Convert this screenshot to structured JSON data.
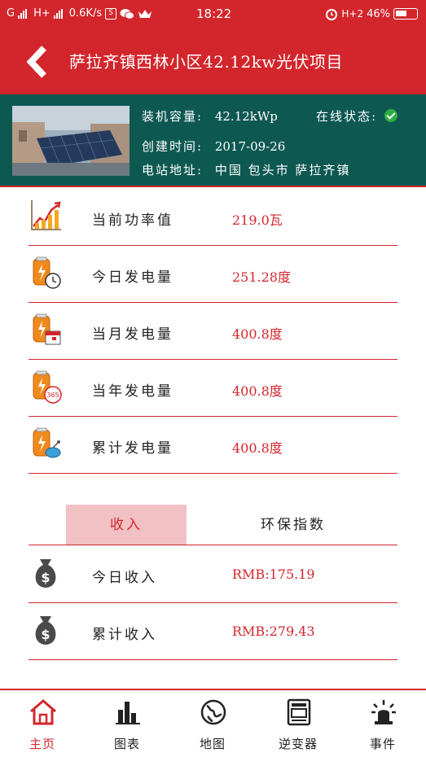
{
  "status_bar": {
    "carrier_1": "G",
    "carrier_2": "H+",
    "speed": "0.6K/s",
    "box_letter": "S",
    "time": "18:22",
    "network": "H+2",
    "battery": "46%"
  },
  "header": {
    "title": "萨拉齐镇西林小区42.12kw光伏项目"
  },
  "station": {
    "capacity_label": "装机容量:",
    "capacity_value": "42.12kWp",
    "online_label": "在线状态:",
    "online_status": "ok",
    "created_label": "创建时间:",
    "created_value": "2017-09-26",
    "address_label": "电站地址:",
    "address_value": "中国 包头市 萨拉齐镇"
  },
  "stats": [
    {
      "label": "当前功率值",
      "value": "219.0瓦",
      "icon": "power-chart-icon"
    },
    {
      "label": "今日发电量",
      "value": "251.28度",
      "icon": "battery-clock-icon"
    },
    {
      "label": "当月发电量",
      "value": "400.8度",
      "icon": "battery-calendar-icon"
    },
    {
      "label": "当年发电量",
      "value": "400.8度",
      "icon": "battery-365-icon",
      "icon_text": "365"
    },
    {
      "label": "累计发电量",
      "value": "400.8度",
      "icon": "battery-satellite-icon"
    }
  ],
  "tabs": [
    {
      "label": "收入",
      "active": true
    },
    {
      "label": "环保指数",
      "active": false
    }
  ],
  "income": [
    {
      "label": "今日收入",
      "value": "RMB:175.19",
      "icon": "money-bag-icon"
    },
    {
      "label": "累计收入",
      "value": "RMB:279.43",
      "icon": "money-bag-icon"
    }
  ],
  "nav": [
    {
      "label": "主页",
      "icon": "home-icon",
      "active": true
    },
    {
      "label": "图表",
      "icon": "bar-chart-icon",
      "active": false
    },
    {
      "label": "地图",
      "icon": "globe-icon",
      "active": false
    },
    {
      "label": "逆变器",
      "icon": "inverter-icon",
      "active": false
    },
    {
      "label": "事件",
      "icon": "alarm-light-icon",
      "active": false
    }
  ],
  "colors": {
    "primary_red": "#d3262c",
    "info_green": "#0e5852",
    "tab_active_bg": "#f1c1c3",
    "online_green": "#2fae43"
  }
}
